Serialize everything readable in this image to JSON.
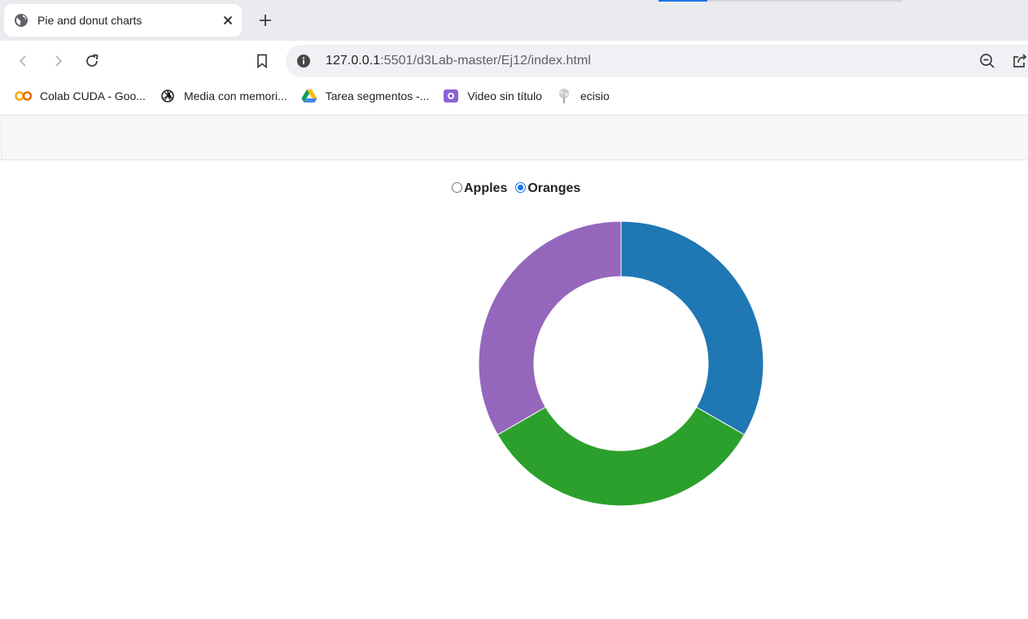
{
  "browser": {
    "tab": {
      "title": "Pie and donut charts",
      "favicon": "globe-icon",
      "close": "close-icon"
    },
    "new_tab": "plus-icon",
    "nav": {
      "back": "back-arrow-icon",
      "forward": "forward-arrow-icon",
      "reload": "reload-icon",
      "bookmark": "bookmark-icon"
    },
    "omnibox": {
      "host": "127.0.0.1",
      "rest": ":5501/d3Lab-master/Ej12/index.html",
      "site_info": "info-icon",
      "zoom": "zoom-out-icon",
      "share": "share-icon"
    },
    "bookmarks": [
      {
        "label": "Colab CUDA - Goo...",
        "icon": "colab-icon"
      },
      {
        "label": "Media con memori...",
        "icon": "openai-icon"
      },
      {
        "label": "Tarea segmentos -...",
        "icon": "drive-icon"
      },
      {
        "label": "Video sin título",
        "icon": "video-icon"
      },
      {
        "label": "ecisio",
        "icon": "tree-icon"
      }
    ]
  },
  "controls": {
    "options": [
      {
        "label": "Apples",
        "checked": false
      },
      {
        "label": "Oranges",
        "checked": true
      }
    ]
  },
  "chart_data": {
    "type": "pie",
    "donut": true,
    "values": [
      1,
      1,
      1
    ],
    "colors": [
      "#1f77b4",
      "#2ca02c",
      "#9467bd"
    ],
    "title": "",
    "legend": "none"
  }
}
